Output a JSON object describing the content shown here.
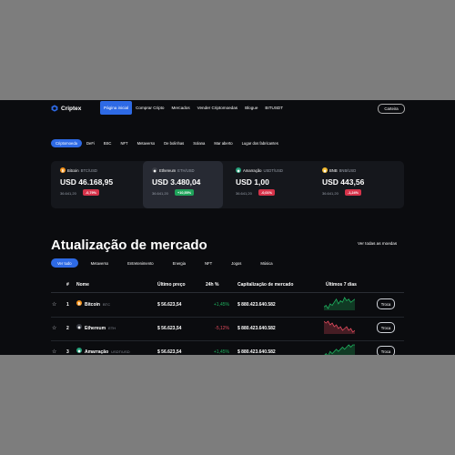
{
  "brand": {
    "name": "Criptex",
    "logo_icon": "cube-icon",
    "accent": "#2e6ae5"
  },
  "nav": {
    "items": [
      "Página inicial",
      "Comprar Cripto",
      "Mercados",
      "Vender Criptomoedas",
      "Blogue",
      "BITUSDT"
    ],
    "active_index": 0,
    "login_label": "Carteira"
  },
  "categories": {
    "items": [
      "Criptomoeda",
      "DeFi",
      "BSC",
      "NFT",
      "Metaverso",
      "De bolinhas",
      "Solana",
      "Mar aberto",
      "Lugar dos fabricantes"
    ],
    "active_index": 0
  },
  "cards": [
    {
      "name": "Bitcoin",
      "pair": "BTC/USD",
      "icon": "bitcoin-icon",
      "icon_color": "#f7931a",
      "price": "USD 46.168,95",
      "volume": "36.641,20",
      "change": "-0,79%",
      "dir": "down",
      "selected": false
    },
    {
      "name": "Ethereum",
      "pair": "ETH/USD",
      "icon": "ethereum-icon",
      "icon_color": "#3a3d45",
      "price": "USD 3.480,04",
      "volume": "36.641,20",
      "change": "+10,55%",
      "dir": "up",
      "selected": true
    },
    {
      "name": "Amarração",
      "pair": "USDT/USD",
      "icon": "tether-icon",
      "icon_color": "#26a17b",
      "price": "USD 1,00",
      "volume": "36.641,20",
      "change": "-0,01%",
      "dir": "down",
      "selected": false
    },
    {
      "name": "BNB",
      "pair": "BNB/USD",
      "icon": "bnb-icon",
      "icon_color": "#f3ba2f",
      "price": "USD 443,56",
      "volume": "36.641,20",
      "change": "-1,24%",
      "dir": "down",
      "selected": false
    }
  ],
  "market": {
    "title": "Atualização de mercado",
    "view_all": "Ver todas as moedas",
    "tabs": [
      "Ver tudo",
      "Metaverso",
      "Entretenimento",
      "Energia",
      "NFT",
      "Jogos",
      "Música"
    ],
    "active_tab": 0,
    "columns": {
      "rank": "#",
      "name": "Nome",
      "price": "Último preço",
      "change": "24h %",
      "cap": "Capitalização de mercado",
      "chart": "Últimos 7 dias"
    },
    "trade_label": "Troca",
    "rows": [
      {
        "rank": "1",
        "name": "Bitcoin",
        "symbol": "BTC",
        "icon": "bitcoin-icon",
        "icon_color": "#f7931a",
        "price": "$ 56.623,54",
        "change": "+1,45%",
        "dir": "up",
        "cap": "$ 880.423.640.582",
        "spark": [
          4,
          5,
          3,
          6,
          5,
          7,
          9,
          6,
          8,
          7,
          10,
          8,
          9,
          7,
          8,
          9
        ],
        "spark_color": "#1fb25f"
      },
      {
        "rank": "2",
        "name": "Ethereum",
        "symbol": "ETH",
        "icon": "ethereum-icon",
        "icon_color": "#3a3d45",
        "price": "$ 56.623,54",
        "change": "-5,12%",
        "dir": "down",
        "cap": "$ 880.423.640.582",
        "spark": [
          9,
          8,
          9,
          7,
          8,
          6,
          7,
          5,
          6,
          4,
          5,
          6,
          4,
          5,
          3,
          4
        ],
        "spark_color": "#e24a5d"
      },
      {
        "rank": "3",
        "name": "Amarração",
        "symbol": "USDT/USD",
        "icon": "tether-icon",
        "icon_color": "#26a17b",
        "price": "$ 56.623,54",
        "change": "+1,45%",
        "dir": "up",
        "cap": "$ 880.423.640.582",
        "spark": [
          4,
          5,
          4,
          6,
          5,
          6,
          7,
          6,
          7,
          8,
          7,
          8,
          9,
          8,
          9,
          9
        ],
        "spark_color": "#1fb25f"
      }
    ]
  }
}
